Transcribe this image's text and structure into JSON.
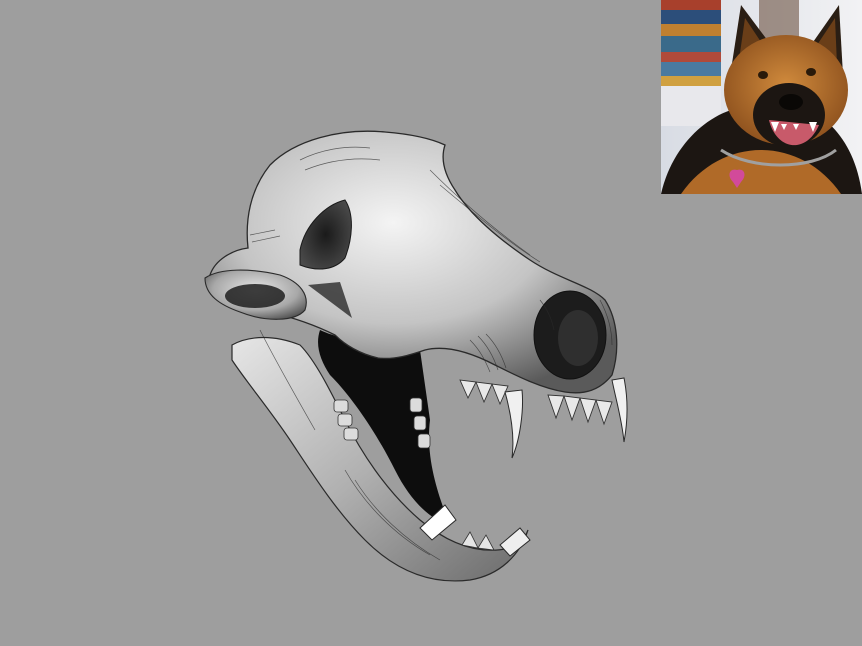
{
  "canvas": {
    "background": "#9e9e9e"
  },
  "artwork": {
    "subject": "skull-drawing",
    "style": "grayscale pencil sketch"
  },
  "reference": {
    "subject": "dog-photo"
  },
  "colors": {
    "bone_light": "#f0f0f0",
    "bone_mid": "#bdbdbd",
    "bone_dark": "#3a3a3a",
    "cavity": "#0d0d0d",
    "fur_tan": "#c07a32",
    "fur_black": "#1c1612",
    "snow": "#e8eaee",
    "tag_pink": "#d24a9a"
  }
}
